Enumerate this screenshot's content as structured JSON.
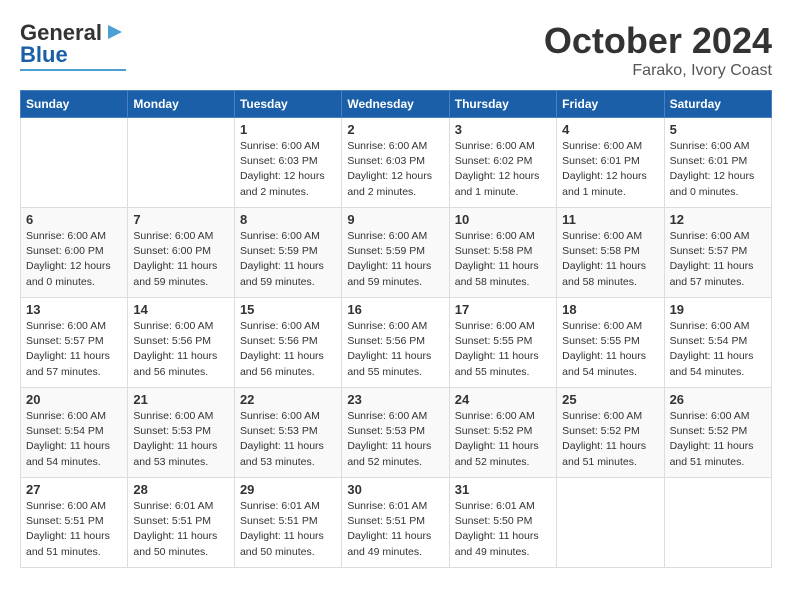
{
  "logo": {
    "text_general": "General",
    "text_blue": "Blue",
    "arrow_color": "#4a9fd4"
  },
  "title": "October 2024",
  "subtitle": "Farako, Ivory Coast",
  "header_color": "#1a5fa8",
  "days_of_week": [
    "Sunday",
    "Monday",
    "Tuesday",
    "Wednesday",
    "Thursday",
    "Friday",
    "Saturday"
  ],
  "weeks": [
    [
      {
        "day": "",
        "info": ""
      },
      {
        "day": "",
        "info": ""
      },
      {
        "day": "1",
        "info": "Sunrise: 6:00 AM\nSunset: 6:03 PM\nDaylight: 12 hours\nand 2 minutes."
      },
      {
        "day": "2",
        "info": "Sunrise: 6:00 AM\nSunset: 6:03 PM\nDaylight: 12 hours\nand 2 minutes."
      },
      {
        "day": "3",
        "info": "Sunrise: 6:00 AM\nSunset: 6:02 PM\nDaylight: 12 hours\nand 1 minute."
      },
      {
        "day": "4",
        "info": "Sunrise: 6:00 AM\nSunset: 6:01 PM\nDaylight: 12 hours\nand 1 minute."
      },
      {
        "day": "5",
        "info": "Sunrise: 6:00 AM\nSunset: 6:01 PM\nDaylight: 12 hours\nand 0 minutes."
      }
    ],
    [
      {
        "day": "6",
        "info": "Sunrise: 6:00 AM\nSunset: 6:00 PM\nDaylight: 12 hours\nand 0 minutes."
      },
      {
        "day": "7",
        "info": "Sunrise: 6:00 AM\nSunset: 6:00 PM\nDaylight: 11 hours\nand 59 minutes."
      },
      {
        "day": "8",
        "info": "Sunrise: 6:00 AM\nSunset: 5:59 PM\nDaylight: 11 hours\nand 59 minutes."
      },
      {
        "day": "9",
        "info": "Sunrise: 6:00 AM\nSunset: 5:59 PM\nDaylight: 11 hours\nand 59 minutes."
      },
      {
        "day": "10",
        "info": "Sunrise: 6:00 AM\nSunset: 5:58 PM\nDaylight: 11 hours\nand 58 minutes."
      },
      {
        "day": "11",
        "info": "Sunrise: 6:00 AM\nSunset: 5:58 PM\nDaylight: 11 hours\nand 58 minutes."
      },
      {
        "day": "12",
        "info": "Sunrise: 6:00 AM\nSunset: 5:57 PM\nDaylight: 11 hours\nand 57 minutes."
      }
    ],
    [
      {
        "day": "13",
        "info": "Sunrise: 6:00 AM\nSunset: 5:57 PM\nDaylight: 11 hours\nand 57 minutes."
      },
      {
        "day": "14",
        "info": "Sunrise: 6:00 AM\nSunset: 5:56 PM\nDaylight: 11 hours\nand 56 minutes."
      },
      {
        "day": "15",
        "info": "Sunrise: 6:00 AM\nSunset: 5:56 PM\nDaylight: 11 hours\nand 56 minutes."
      },
      {
        "day": "16",
        "info": "Sunrise: 6:00 AM\nSunset: 5:56 PM\nDaylight: 11 hours\nand 55 minutes."
      },
      {
        "day": "17",
        "info": "Sunrise: 6:00 AM\nSunset: 5:55 PM\nDaylight: 11 hours\nand 55 minutes."
      },
      {
        "day": "18",
        "info": "Sunrise: 6:00 AM\nSunset: 5:55 PM\nDaylight: 11 hours\nand 54 minutes."
      },
      {
        "day": "19",
        "info": "Sunrise: 6:00 AM\nSunset: 5:54 PM\nDaylight: 11 hours\nand 54 minutes."
      }
    ],
    [
      {
        "day": "20",
        "info": "Sunrise: 6:00 AM\nSunset: 5:54 PM\nDaylight: 11 hours\nand 54 minutes."
      },
      {
        "day": "21",
        "info": "Sunrise: 6:00 AM\nSunset: 5:53 PM\nDaylight: 11 hours\nand 53 minutes."
      },
      {
        "day": "22",
        "info": "Sunrise: 6:00 AM\nSunset: 5:53 PM\nDaylight: 11 hours\nand 53 minutes."
      },
      {
        "day": "23",
        "info": "Sunrise: 6:00 AM\nSunset: 5:53 PM\nDaylight: 11 hours\nand 52 minutes."
      },
      {
        "day": "24",
        "info": "Sunrise: 6:00 AM\nSunset: 5:52 PM\nDaylight: 11 hours\nand 52 minutes."
      },
      {
        "day": "25",
        "info": "Sunrise: 6:00 AM\nSunset: 5:52 PM\nDaylight: 11 hours\nand 51 minutes."
      },
      {
        "day": "26",
        "info": "Sunrise: 6:00 AM\nSunset: 5:52 PM\nDaylight: 11 hours\nand 51 minutes."
      }
    ],
    [
      {
        "day": "27",
        "info": "Sunrise: 6:00 AM\nSunset: 5:51 PM\nDaylight: 11 hours\nand 51 minutes."
      },
      {
        "day": "28",
        "info": "Sunrise: 6:01 AM\nSunset: 5:51 PM\nDaylight: 11 hours\nand 50 minutes."
      },
      {
        "day": "29",
        "info": "Sunrise: 6:01 AM\nSunset: 5:51 PM\nDaylight: 11 hours\nand 50 minutes."
      },
      {
        "day": "30",
        "info": "Sunrise: 6:01 AM\nSunset: 5:51 PM\nDaylight: 11 hours\nand 49 minutes."
      },
      {
        "day": "31",
        "info": "Sunrise: 6:01 AM\nSunset: 5:50 PM\nDaylight: 11 hours\nand 49 minutes."
      },
      {
        "day": "",
        "info": ""
      },
      {
        "day": "",
        "info": ""
      }
    ]
  ]
}
